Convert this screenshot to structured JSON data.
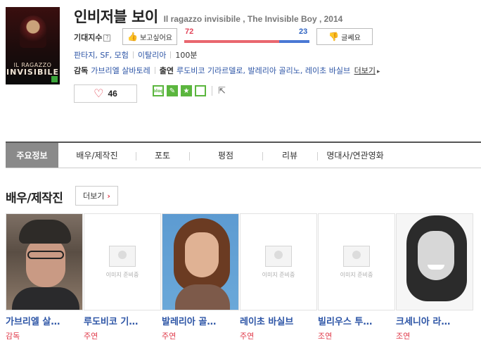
{
  "movie": {
    "title_ko": "인비저블 보이",
    "title_orig": "Il ragazzo invisibile , The Invisible Boy , 2014",
    "poster": {
      "title_small": "IL RAGAZZO",
      "title_big": "INVISIBILE"
    }
  },
  "expectation": {
    "label": "기대지수",
    "help": "?",
    "like_button": "보고싶어요",
    "like_count": "72",
    "dislike_count": "23",
    "like_ratio": 0.758,
    "dislike_button": "글쎄요",
    "colors": {
      "like": "#e9676f",
      "dislike": "#4a78d4"
    }
  },
  "meta": {
    "genres": "판타지, SF, 모험",
    "country": "이탈리아",
    "runtime": "100분"
  },
  "crew": {
    "director_label": "감독",
    "director": "가브리엘 살바토레",
    "cast_label": "출연",
    "cast": "루도비코 기라르델로, 발레리아 골리노, 레이초 바실브",
    "more": "더보기"
  },
  "favorite": {
    "count": "46"
  },
  "share": {
    "icons": [
      "blog-icon",
      "me2day-icon",
      "yozm-icon",
      "clog-icon",
      "share-export-icon"
    ],
    "blog_label": "blog"
  },
  "tabs": [
    {
      "label": "주요정보",
      "active": true
    },
    {
      "label": "배우/제작진",
      "active": false
    },
    {
      "label": "포토",
      "active": false
    },
    {
      "label": "평점",
      "active": false
    },
    {
      "label": "리뷰",
      "active": false
    },
    {
      "label": "명대사/연관영화",
      "active": false
    }
  ],
  "cast_section": {
    "title": "배우/제작진",
    "more": "더보기",
    "placeholder_text": "이미지 준비중",
    "people": [
      {
        "name": "가브리엘 살…",
        "role": "감독",
        "photo": "person"
      },
      {
        "name": "루도비코 기…",
        "role": "주연",
        "photo": "placeholder"
      },
      {
        "name": "발레리아 골…",
        "role": "주연",
        "photo": "person"
      },
      {
        "name": "레이초 바실브",
        "role": "주연",
        "photo": "placeholder"
      },
      {
        "name": "빌리우스 투…",
        "role": "조연",
        "photo": "placeholder"
      },
      {
        "name": "크세니아 라…",
        "role": "조연",
        "photo": "person"
      }
    ]
  }
}
